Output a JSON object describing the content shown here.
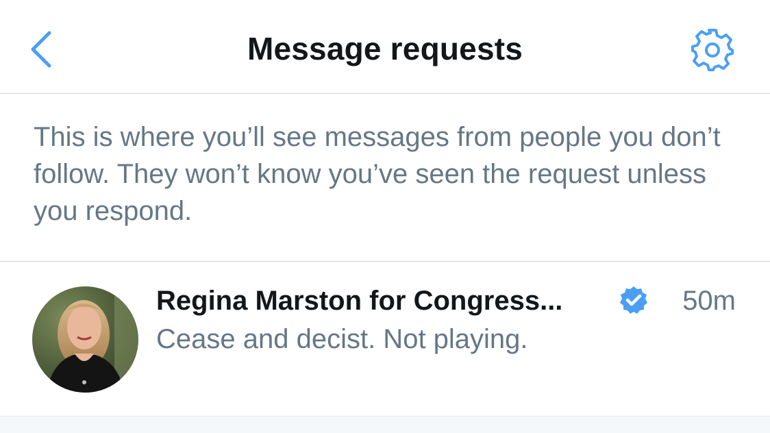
{
  "header": {
    "title": "Message requests",
    "back_icon": "chevron-left-icon",
    "settings_icon": "gear-icon"
  },
  "info": {
    "text": "This is where you’ll see messages from people you don’t follow. They won’t know you’ve seen the request unless you respond."
  },
  "conversation": {
    "name": "Regina Marston for Congress...",
    "verified": true,
    "time": "50m",
    "preview": "Cease and decist. Not playing."
  },
  "colors": {
    "accent": "#4a9ff5",
    "text_primary": "#14171a",
    "text_secondary": "#657786",
    "divider": "#ccd2d7"
  }
}
